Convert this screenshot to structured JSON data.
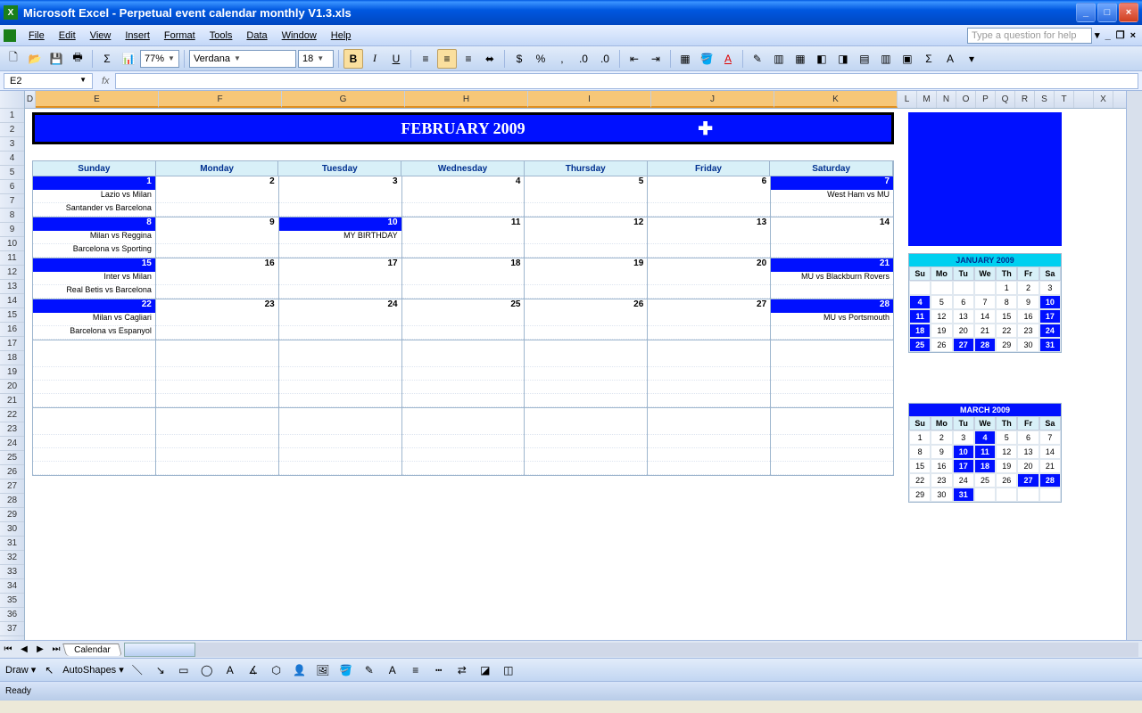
{
  "titlebar": {
    "app": "Microsoft Excel",
    "doc": "Perpetual event calendar monthly V1.3.xls"
  },
  "menus": [
    "File",
    "Edit",
    "View",
    "Insert",
    "Format",
    "Tools",
    "Data",
    "Window",
    "Help"
  ],
  "helpbox_placeholder": "Type a question for help",
  "toolbar1": {
    "zoom": "77%",
    "font": "Verdana",
    "size": "18"
  },
  "namebox": "E2",
  "calendar": {
    "title": "FEBRUARY 2009",
    "days": [
      "Sunday",
      "Monday",
      "Tuesday",
      "Wednesday",
      "Thursday",
      "Friday",
      "Saturday"
    ],
    "weeks": [
      [
        {
          "n": "1",
          "hl": true,
          "ev": [
            "Lazio vs Milan",
            "Santander vs Barcelona"
          ]
        },
        {
          "n": "2",
          "ev": [
            "",
            ""
          ]
        },
        {
          "n": "3",
          "ev": [
            "",
            ""
          ]
        },
        {
          "n": "4",
          "ev": [
            "",
            ""
          ]
        },
        {
          "n": "5",
          "ev": [
            "",
            ""
          ]
        },
        {
          "n": "6",
          "ev": [
            "",
            ""
          ]
        },
        {
          "n": "7",
          "hl": true,
          "ev": [
            "West Ham vs MU",
            ""
          ]
        }
      ],
      [
        {
          "n": "8",
          "hl": true,
          "ev": [
            "Milan vs Reggina",
            "Barcelona vs Sporting"
          ]
        },
        {
          "n": "9",
          "ev": [
            "",
            ""
          ]
        },
        {
          "n": "10",
          "hl": true,
          "ev": [
            "MY BIRTHDAY",
            ""
          ]
        },
        {
          "n": "11",
          "ev": [
            "",
            ""
          ]
        },
        {
          "n": "12",
          "ev": [
            "",
            ""
          ]
        },
        {
          "n": "13",
          "ev": [
            "",
            ""
          ]
        },
        {
          "n": "14",
          "ev": [
            "",
            ""
          ]
        }
      ],
      [
        {
          "n": "15",
          "hl": true,
          "ev": [
            "Inter vs Milan",
            "Real Betis vs Barcelona"
          ]
        },
        {
          "n": "16",
          "ev": [
            "",
            ""
          ]
        },
        {
          "n": "17",
          "ev": [
            "",
            ""
          ]
        },
        {
          "n": "18",
          "ev": [
            "",
            ""
          ]
        },
        {
          "n": "19",
          "ev": [
            "",
            ""
          ]
        },
        {
          "n": "20",
          "ev": [
            "",
            ""
          ]
        },
        {
          "n": "21",
          "hl": true,
          "ev": [
            "MU vs Blackburn Rovers",
            ""
          ]
        }
      ],
      [
        {
          "n": "22",
          "hl": true,
          "ev": [
            "Milan vs Cagliari",
            "Barcelona vs Espanyol"
          ]
        },
        {
          "n": "23",
          "ev": [
            "",
            ""
          ]
        },
        {
          "n": "24",
          "ev": [
            "",
            ""
          ]
        },
        {
          "n": "25",
          "ev": [
            "",
            ""
          ]
        },
        {
          "n": "26",
          "ev": [
            "",
            ""
          ]
        },
        {
          "n": "27",
          "ev": [
            "",
            ""
          ]
        },
        {
          "n": "28",
          "hl": true,
          "ev": [
            "MU vs Portsmouth",
            ""
          ]
        }
      ],
      [
        {
          "n": "",
          "ev": [
            "",
            "",
            "",
            ""
          ]
        },
        {
          "n": "",
          "ev": [
            "",
            "",
            "",
            ""
          ]
        },
        {
          "n": "",
          "ev": [
            "",
            "",
            "",
            ""
          ]
        },
        {
          "n": "",
          "ev": [
            "",
            "",
            "",
            ""
          ]
        },
        {
          "n": "",
          "ev": [
            "",
            "",
            "",
            ""
          ]
        },
        {
          "n": "",
          "ev": [
            "",
            "",
            "",
            ""
          ]
        },
        {
          "n": "",
          "ev": [
            "",
            "",
            "",
            ""
          ]
        }
      ],
      [
        {
          "n": "",
          "ev": [
            "",
            "",
            "",
            ""
          ]
        },
        {
          "n": "",
          "ev": [
            "",
            "",
            "",
            ""
          ]
        },
        {
          "n": "",
          "ev": [
            "",
            "",
            "",
            ""
          ]
        },
        {
          "n": "",
          "ev": [
            "",
            "",
            "",
            ""
          ]
        },
        {
          "n": "",
          "ev": [
            "",
            "",
            "",
            ""
          ]
        },
        {
          "n": "",
          "ev": [
            "",
            "",
            "",
            ""
          ]
        },
        {
          "n": "",
          "ev": [
            "",
            "",
            "",
            ""
          ]
        }
      ]
    ]
  },
  "mini_prev": {
    "title": "JANUARY 2009",
    "head": [
      "Su",
      "Mo",
      "Tu",
      "We",
      "Th",
      "Fr",
      "Sa"
    ],
    "rows": [
      [
        {
          "n": ""
        },
        {
          "n": ""
        },
        {
          "n": ""
        },
        {
          "n": ""
        },
        {
          "n": "1"
        },
        {
          "n": "2"
        },
        {
          "n": "3"
        }
      ],
      [
        {
          "n": "4",
          "hl": true
        },
        {
          "n": "5"
        },
        {
          "n": "6"
        },
        {
          "n": "7"
        },
        {
          "n": "8"
        },
        {
          "n": "9"
        },
        {
          "n": "10",
          "hl": true
        }
      ],
      [
        {
          "n": "11",
          "hl": true
        },
        {
          "n": "12"
        },
        {
          "n": "13"
        },
        {
          "n": "14"
        },
        {
          "n": "15"
        },
        {
          "n": "16"
        },
        {
          "n": "17",
          "hl": true
        }
      ],
      [
        {
          "n": "18",
          "hl": true
        },
        {
          "n": "19"
        },
        {
          "n": "20"
        },
        {
          "n": "21"
        },
        {
          "n": "22"
        },
        {
          "n": "23"
        },
        {
          "n": "24",
          "hl": true
        }
      ],
      [
        {
          "n": "25",
          "hl": true
        },
        {
          "n": "26"
        },
        {
          "n": "27",
          "hl": true
        },
        {
          "n": "28",
          "hl": true
        },
        {
          "n": "29"
        },
        {
          "n": "30"
        },
        {
          "n": "31",
          "hl": true
        }
      ]
    ]
  },
  "mini_next": {
    "title": "MARCH 2009",
    "head": [
      "Su",
      "Mo",
      "Tu",
      "We",
      "Th",
      "Fr",
      "Sa"
    ],
    "rows": [
      [
        {
          "n": "1"
        },
        {
          "n": "2"
        },
        {
          "n": "3"
        },
        {
          "n": "4",
          "hl": true
        },
        {
          "n": "5"
        },
        {
          "n": "6"
        },
        {
          "n": "7"
        }
      ],
      [
        {
          "n": "8"
        },
        {
          "n": "9"
        },
        {
          "n": "10",
          "hl": true
        },
        {
          "n": "11",
          "hl": true
        },
        {
          "n": "12"
        },
        {
          "n": "13"
        },
        {
          "n": "14"
        }
      ],
      [
        {
          "n": "15"
        },
        {
          "n": "16"
        },
        {
          "n": "17",
          "hl": true
        },
        {
          "n": "18",
          "hl": true
        },
        {
          "n": "19"
        },
        {
          "n": "20"
        },
        {
          "n": "21"
        }
      ],
      [
        {
          "n": "22"
        },
        {
          "n": "23"
        },
        {
          "n": "24"
        },
        {
          "n": "25"
        },
        {
          "n": "26"
        },
        {
          "n": "27",
          "hl": true
        },
        {
          "n": "28",
          "hl": true
        }
      ],
      [
        {
          "n": "29"
        },
        {
          "n": "30"
        },
        {
          "n": "31",
          "hl": true
        },
        {
          "n": ""
        },
        {
          "n": ""
        },
        {
          "n": ""
        },
        {
          "n": ""
        }
      ]
    ]
  },
  "columns_main": [
    "D",
    "E",
    "F",
    "G",
    "H",
    "I",
    "J",
    "K"
  ],
  "columns_tiny": [
    "L",
    "M",
    "N",
    "O",
    "P",
    "Q",
    "R",
    "S",
    "T",
    "",
    "X"
  ],
  "row_numbers": [
    1,
    2,
    3,
    4,
    5,
    6,
    7,
    8,
    9,
    10,
    11,
    12,
    13,
    14,
    15,
    16,
    17,
    18,
    19,
    20,
    21,
    22,
    23,
    24,
    25,
    26,
    27,
    28,
    29,
    30,
    31,
    32,
    33,
    34,
    35,
    36,
    37
  ],
  "sheet_tab": "Calendar",
  "drawbar": {
    "draw": "Draw",
    "autoshapes": "AutoShapes"
  },
  "status": "Ready"
}
